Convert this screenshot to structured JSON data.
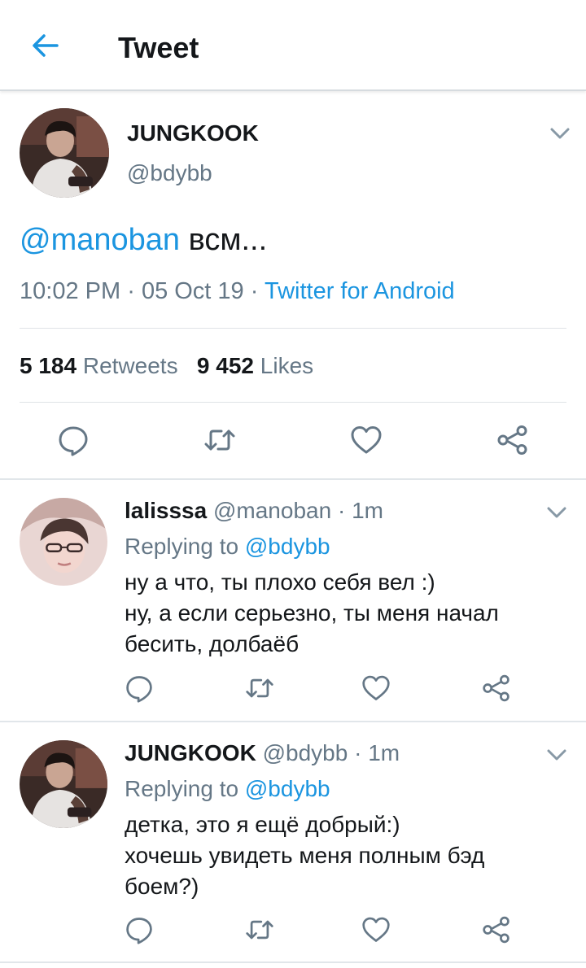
{
  "header": {
    "title": "Tweet"
  },
  "tweet": {
    "name": "JUNGKOOK",
    "handle": "@bdybb",
    "mention": "@manoban",
    "text": "всм...",
    "time": "10:02 PM",
    "date": "05 Oct 19",
    "source": "Twitter for Android",
    "meta_sep": "·",
    "retweets_count": "5 184",
    "retweets_label": "Retweets",
    "likes_count": "9 452",
    "likes_label": "Likes"
  },
  "replies": [
    {
      "name": "lalisssa",
      "handle": "@manoban",
      "age": "1m",
      "replying_prefix": "Replying to",
      "replying_to": "@bdybb",
      "lines": [
        "ну а что, ты плохо себя вел :)",
        "ну, а если серьезно, ты меня начал",
        "бесить, долбаёб"
      ]
    },
    {
      "name": "JUNGKOOK",
      "handle": "@bdybb",
      "age": "1m",
      "replying_prefix": "Replying to",
      "replying_to": "@bdybb",
      "lines": [
        "детка, это я ещё добрый:)",
        "хочешь увидеть меня полным бэд",
        "боем?)"
      ]
    }
  ],
  "icons": {
    "back": "arrow-left",
    "menu": "chevron-down",
    "reply": "speech-bubble",
    "retweet": "retweet-arrows",
    "like": "heart",
    "share": "share-nodes"
  },
  "colors": {
    "accent": "#1b95e0",
    "text": "#14171a",
    "secondary": "#657786",
    "icon": "#657786",
    "divider": "#e1e6ea"
  }
}
